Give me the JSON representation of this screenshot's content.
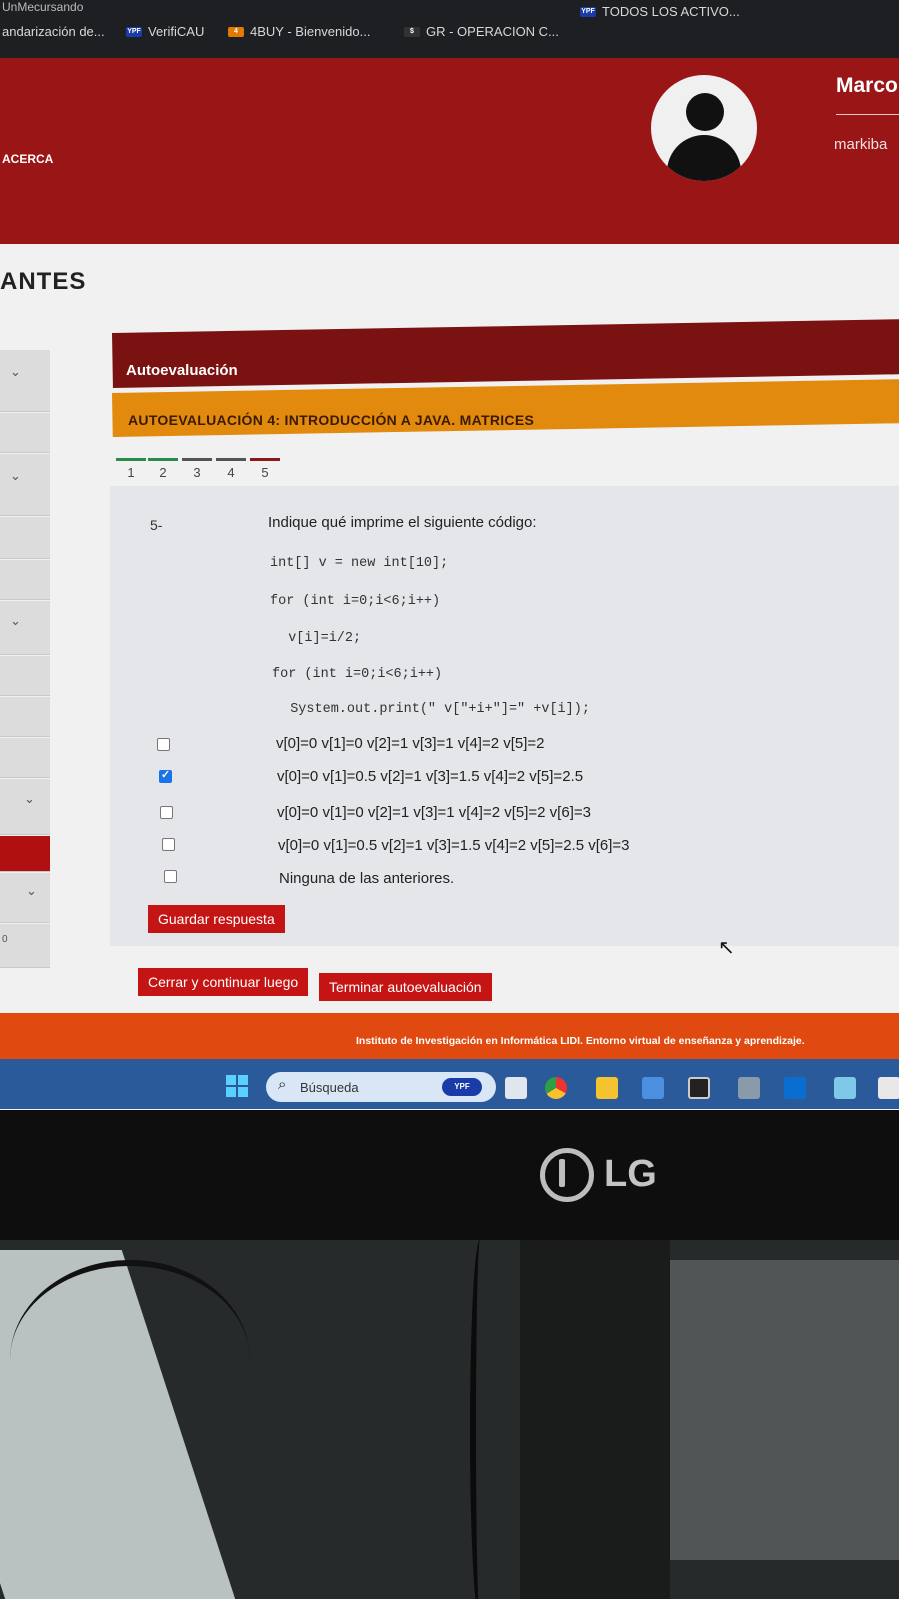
{
  "bookmarks": {
    "top_partial": "UnMecursando",
    "items": [
      {
        "label": "andarización de..."
      },
      {
        "label": "VerifiCAU",
        "icon": "ypf-icon"
      },
      {
        "label": "4BUY - Bienvenido...",
        "icon": "4buy-icon"
      },
      {
        "label": "GR - OPERACION C...",
        "icon": "gr-icon"
      },
      {
        "label": "TODOS LOS ACTIVO...",
        "icon": "ypf-icon"
      }
    ]
  },
  "header": {
    "nav_acerca": "ACERCA",
    "user_name": "Marco",
    "user_login": "markiba",
    "brand_color": "#9a1515"
  },
  "page": {
    "title": "ANTES"
  },
  "section": {
    "title": "Autoevaluación"
  },
  "quiz": {
    "title": "AUTOEVALUACIÓN 4: INTRODUCCIÓN A JAVA. MATRICES",
    "steps": [
      "1",
      "2",
      "3",
      "4",
      "5"
    ],
    "question_number": "5-",
    "question_text": "Indique qué imprime el siguiente código:",
    "code_lines": [
      "int[] v = new int[10];",
      "for (int i=0;i<6;i++)",
      "  v[i]=i/2;",
      "for (int i=0;i<6;i++)",
      "  System.out.print(\" v[\"+i+\"]=\" +v[i]);"
    ],
    "options": [
      {
        "label": "v[0]=0 v[1]=0 v[2]=1 v[3]=1 v[4]=2 v[5]=2",
        "checked": false
      },
      {
        "label": "v[0]=0 v[1]=0.5 v[2]=1 v[3]=1.5 v[4]=2 v[5]=2.5",
        "checked": true
      },
      {
        "label": "v[0]=0 v[1]=0 v[2]=1 v[3]=1 v[4]=2 v[5]=2 v[6]=3",
        "checked": false
      },
      {
        "label": "v[0]=0 v[1]=0.5 v[2]=1 v[3]=1.5 v[4]=2 v[5]=2.5 v[6]=3",
        "checked": false
      },
      {
        "label": "Ninguna de las anteriores.",
        "checked": false
      }
    ],
    "save_button": "Guardar respuesta",
    "close_button": "Cerrar y continuar luego",
    "finish_button": "Terminar autoevaluación"
  },
  "footer": {
    "text": "Instituto de Investigación en Informática LIDI. Entorno virtual de enseñanza y aprendizaje."
  },
  "sidebar": {
    "bottom_label": "0"
  },
  "taskbar": {
    "search_label": "Búsqueda",
    "search_badge": "YPF",
    "apps": [
      "task-view-icon",
      "chrome-icon",
      "file-explorer-icon",
      "app-icon",
      "terminal-icon",
      "settings-icon",
      "outlook-icon",
      "notepad-icon",
      "calendar-icon"
    ]
  },
  "monitor": {
    "brand": "LG"
  }
}
